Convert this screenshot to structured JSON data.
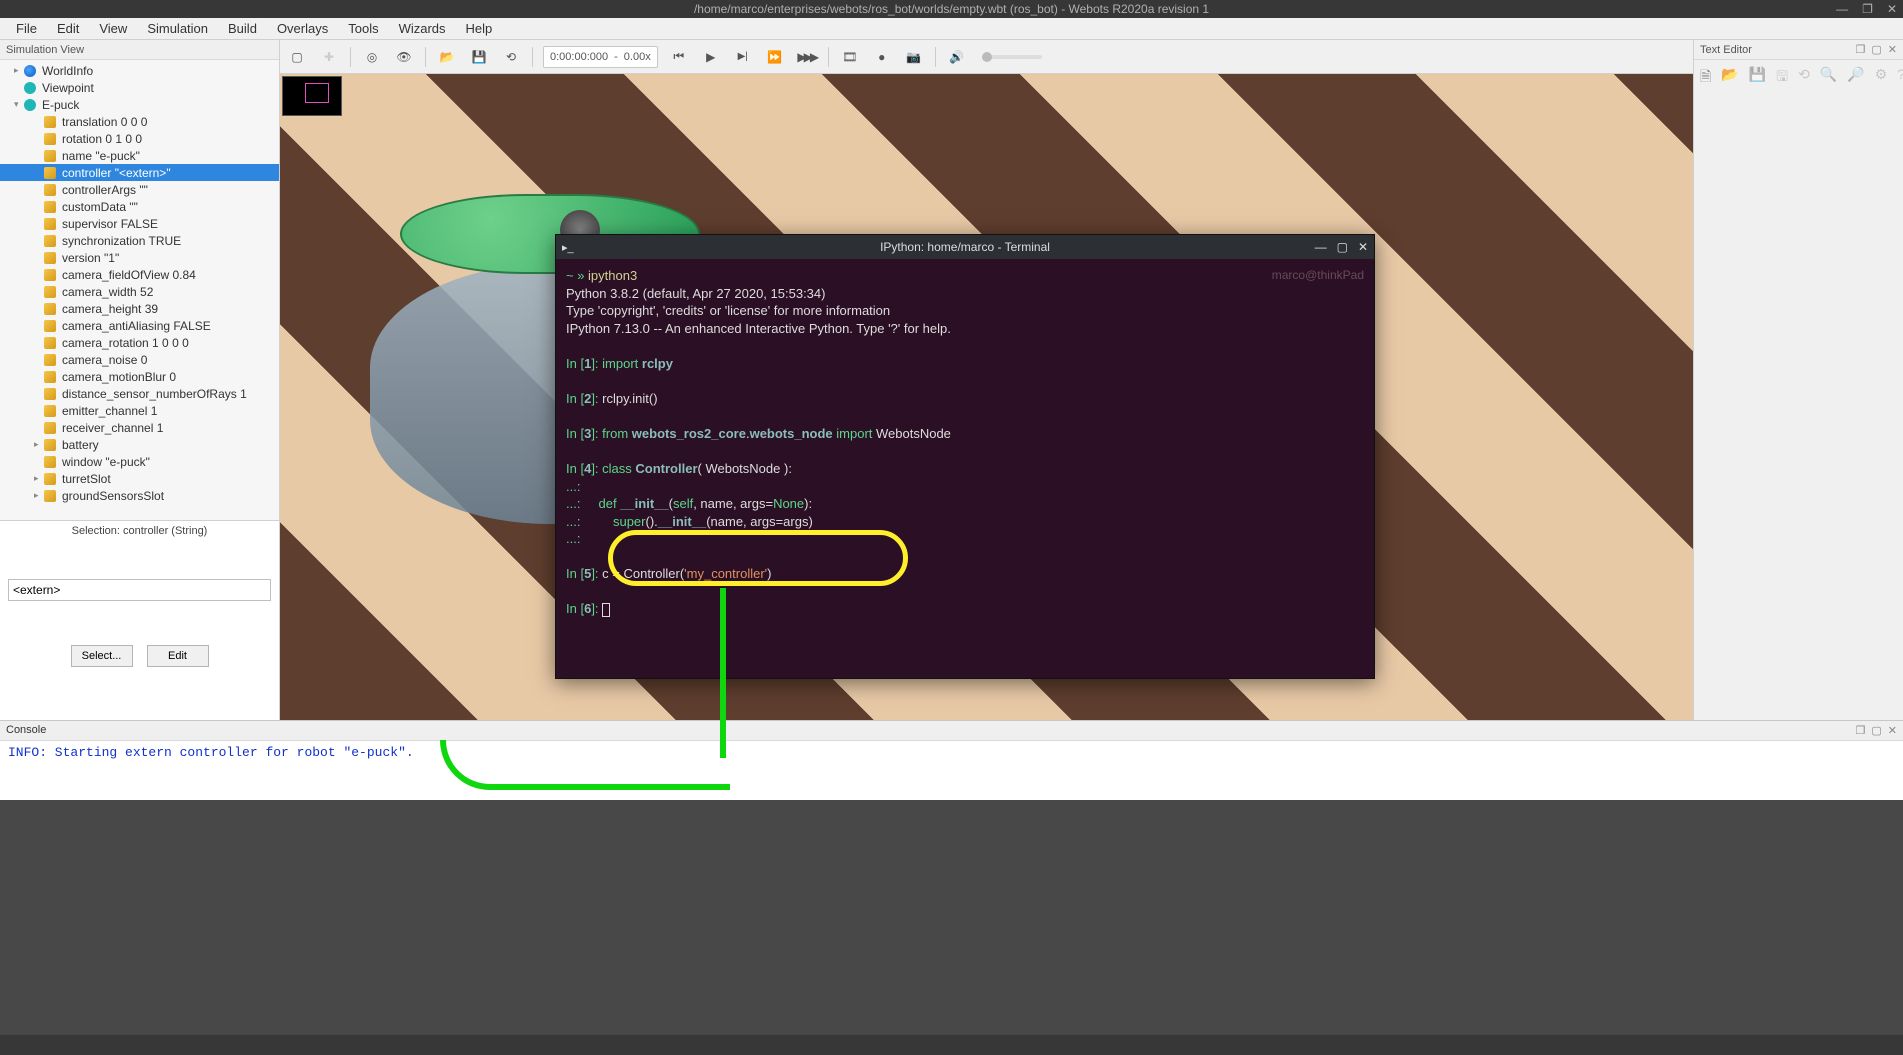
{
  "titlebar": {
    "title": "/home/marco/enterprises/webots/ros_bot/worlds/empty.wbt (ros_bot) - Webots R2020a revision 1"
  },
  "menu": [
    "File",
    "Edit",
    "View",
    "Simulation",
    "Build",
    "Overlays",
    "Tools",
    "Wizards",
    "Help"
  ],
  "panes": {
    "simview": "Simulation View",
    "texteditor": "Text Editor",
    "console": "Console"
  },
  "toolbar": {
    "time": "0:00:00:000",
    "speed": "0.00x"
  },
  "tree": {
    "nodes": [
      {
        "type": "globe",
        "label": "WorldInfo",
        "indent": 14,
        "arrow": "▸"
      },
      {
        "type": "cam",
        "label": "Viewpoint",
        "indent": 14,
        "arrow": ""
      },
      {
        "type": "cam",
        "label": "E-puck",
        "indent": 14,
        "arrow": "▾"
      },
      {
        "type": "cube",
        "label": "translation 0 0 0",
        "indent": 34,
        "arrow": ""
      },
      {
        "type": "cube",
        "label": "rotation 0 1 0 0",
        "indent": 34,
        "arrow": ""
      },
      {
        "type": "cube",
        "label": "name \"e-puck\"",
        "indent": 34,
        "arrow": ""
      },
      {
        "type": "cube",
        "label": "controller \"<extern>\"",
        "indent": 34,
        "arrow": "",
        "sel": true
      },
      {
        "type": "cube",
        "label": "controllerArgs \"\"",
        "indent": 34,
        "arrow": ""
      },
      {
        "type": "cube",
        "label": "customData \"\"",
        "indent": 34,
        "arrow": ""
      },
      {
        "type": "cube",
        "label": "supervisor FALSE",
        "indent": 34,
        "arrow": ""
      },
      {
        "type": "cube",
        "label": "synchronization TRUE",
        "indent": 34,
        "arrow": ""
      },
      {
        "type": "cube",
        "label": "version \"1\"",
        "indent": 34,
        "arrow": ""
      },
      {
        "type": "cube",
        "label": "camera_fieldOfView 0.84",
        "indent": 34,
        "arrow": ""
      },
      {
        "type": "cube",
        "label": "camera_width 52",
        "indent": 34,
        "arrow": ""
      },
      {
        "type": "cube",
        "label": "camera_height 39",
        "indent": 34,
        "arrow": ""
      },
      {
        "type": "cube",
        "label": "camera_antiAliasing FALSE",
        "indent": 34,
        "arrow": ""
      },
      {
        "type": "cube",
        "label": "camera_rotation 1 0 0 0",
        "indent": 34,
        "arrow": ""
      },
      {
        "type": "cube",
        "label": "camera_noise 0",
        "indent": 34,
        "arrow": ""
      },
      {
        "type": "cube",
        "label": "camera_motionBlur 0",
        "indent": 34,
        "arrow": ""
      },
      {
        "type": "cube",
        "label": "distance_sensor_numberOfRays 1",
        "indent": 34,
        "arrow": ""
      },
      {
        "type": "cube",
        "label": "emitter_channel 1",
        "indent": 34,
        "arrow": ""
      },
      {
        "type": "cube",
        "label": "receiver_channel 1",
        "indent": 34,
        "arrow": ""
      },
      {
        "type": "cube",
        "label": "battery",
        "indent": 34,
        "arrow": "▸"
      },
      {
        "type": "cube",
        "label": "window \"e-puck\"",
        "indent": 34,
        "arrow": ""
      },
      {
        "type": "cube",
        "label": "turretSlot",
        "indent": 34,
        "arrow": "▸"
      },
      {
        "type": "cube",
        "label": "groundSensorsSlot",
        "indent": 34,
        "arrow": "▸"
      }
    ]
  },
  "selection": {
    "label": "Selection: controller (String)",
    "value": "<extern>",
    "select_btn": "Select...",
    "edit_btn": "Edit"
  },
  "terminal": {
    "title": "IPython: home/marco - Terminal",
    "host": "marco@thinkPad",
    "prompt": "~ » ",
    "cmd": "ipython3",
    "line_py": "Python 3.8.2 (default, Apr 27 2020, 15:53:34)",
    "line_info": "Type 'copyright', 'credits' or 'license' for more information",
    "line_ip": "IPython 7.13.0 -- An enhanced Interactive Python. Type '?' for help.",
    "in": "In [",
    "inend": "]: ",
    "n1": "1",
    "c1_kw": "import ",
    "c1_mod": "rclpy",
    "n2": "2",
    "c2": "rclpy.init()",
    "n3": "3",
    "c3_kw": "from ",
    "c3_mod": "webots_ros2_core",
    "c3_dot": ".",
    "c3_sub": "webots_node ",
    "c3_imp": "import ",
    "c3_cls": "WebotsNode",
    "n4": "4",
    "c4_kw": "class ",
    "c4_cls": "Controller",
    "c4_rest": "( WebotsNode ):",
    "cont": "   ...: ",
    "c4l2_def": "def ",
    "c4l2_init": "__init__",
    "c4l2_op": "(",
    "c4l2_self": "self",
    "c4l2_mid": ", name, args=",
    "c4l2_none": "None",
    "c4l2_cl": "):",
    "c4l3_sup": "super",
    "c4l3_op": "().",
    "c4l3_init": "__init__",
    "c4l3_rest": "(name, args=args)",
    "n5": "5",
    "c5_pre": "c = Controller(",
    "c5_str": "'my_controller'",
    "c5_post": ")",
    "n6": "6"
  },
  "console": {
    "text": "INFO: Starting extern controller for robot \"e-puck\"."
  }
}
